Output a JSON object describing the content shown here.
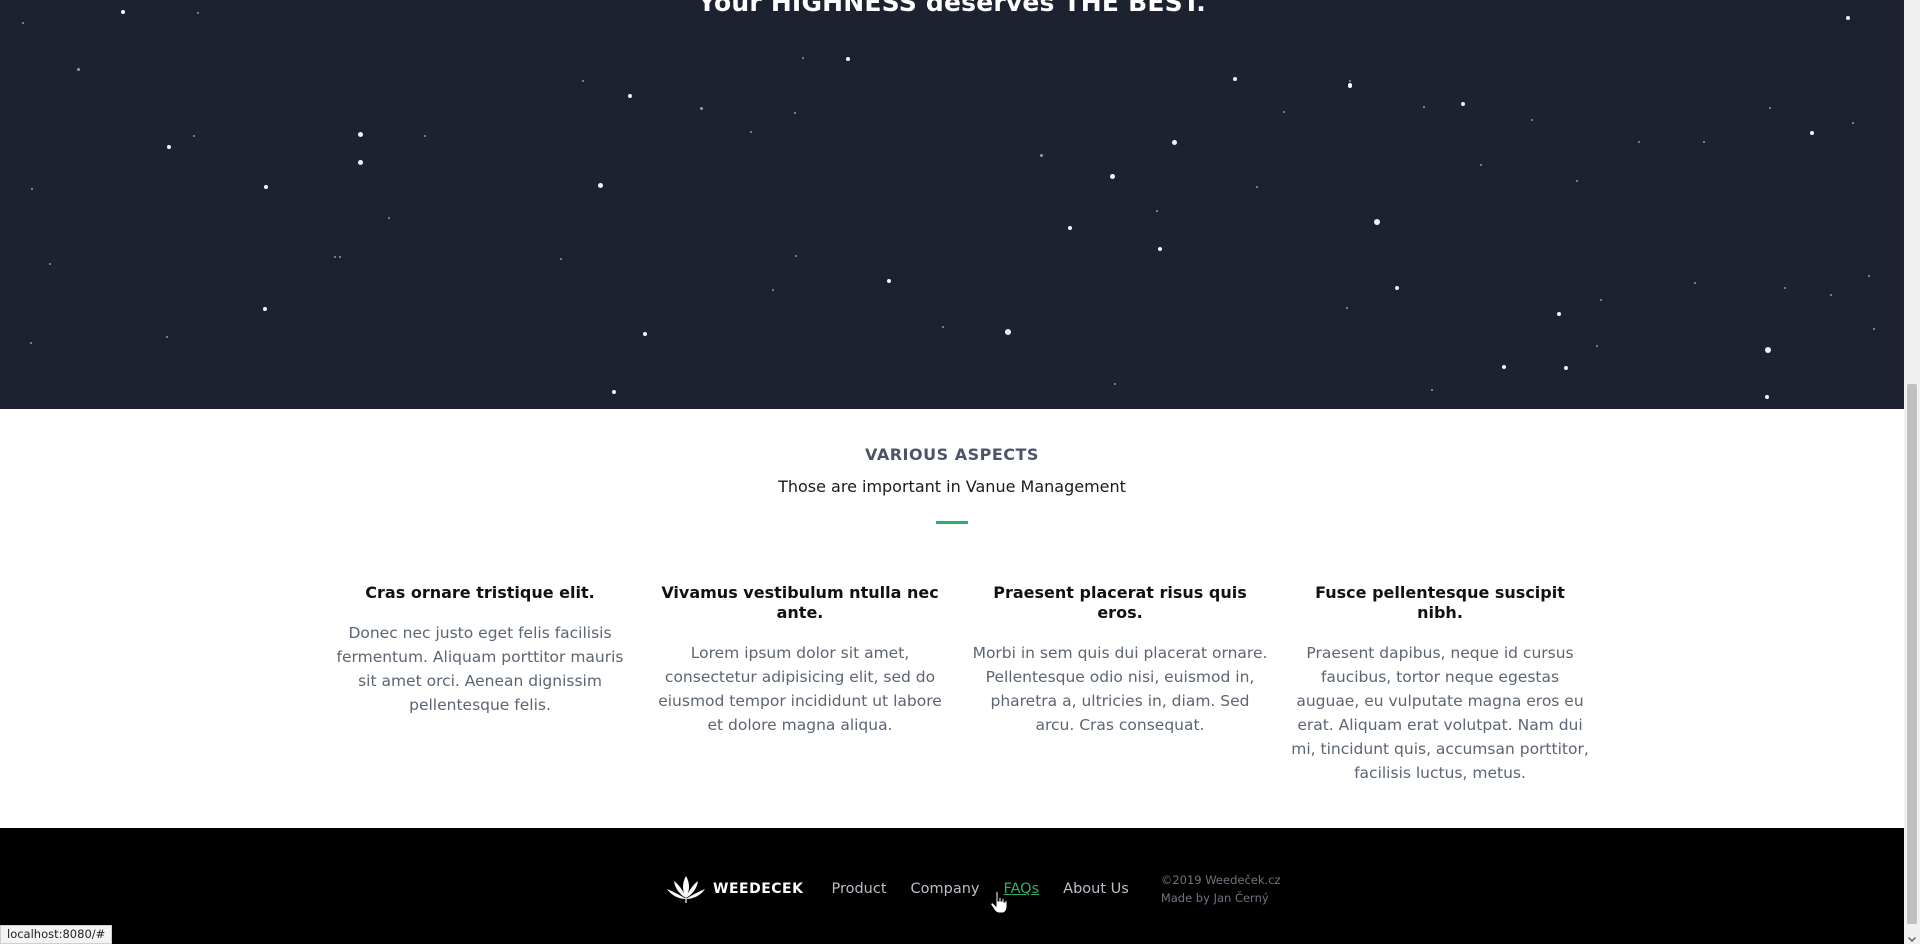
{
  "hero": {
    "tagline": "Your HIGHNESS deserves THE BEST."
  },
  "aspects": {
    "title": "VARIOUS ASPECTS",
    "subtitle": "Those are important in Vanue Management",
    "accent_color": "#2eae6b",
    "features": [
      {
        "title": "Cras ornare tristique elit.",
        "text": "Donec nec justo eget felis facilisis fermentum. Aliquam porttitor mauris sit amet orci. Aenean dignissim pellentesque felis."
      },
      {
        "title": "Vivamus vestibulum ntulla nec ante.",
        "text": "Lorem ipsum dolor sit amet, consectetur adipisicing elit, sed do eiusmod tempor incididunt ut labore et dolore magna aliqua."
      },
      {
        "title": "Praesent placerat risus quis eros.",
        "text": "Morbi in sem quis dui placerat ornare. Pellentesque odio nisi, euismod in, pharetra a, ultricies in, diam. Sed arcu. Cras consequat."
      },
      {
        "title": "Fusce pellentesque suscipit nibh.",
        "text": "Praesent dapibus, neque id cursus faucibus, tortor neque egestas auguae, eu vulputate magna eros eu erat. Aliquam erat volutpat. Nam dui mi, tincidunt quis, accumsan porttitor, facilisis luctus, metus."
      }
    ]
  },
  "footer": {
    "brand": "WEEDECEK",
    "logo_icon": "lotus-leaf-icon",
    "links": [
      {
        "label": "Product"
      },
      {
        "label": "Company"
      },
      {
        "label": "FAQs"
      },
      {
        "label": "About Us"
      }
    ],
    "copyright": "©2019 Weedeček.cz",
    "made_by": "Made by Jan Černý"
  },
  "status_bar": {
    "url": "localhost:8080/#"
  },
  "colors": {
    "hero_background": "#1d2230",
    "footer_background": "#000000",
    "link_active": "#2eae6b"
  }
}
